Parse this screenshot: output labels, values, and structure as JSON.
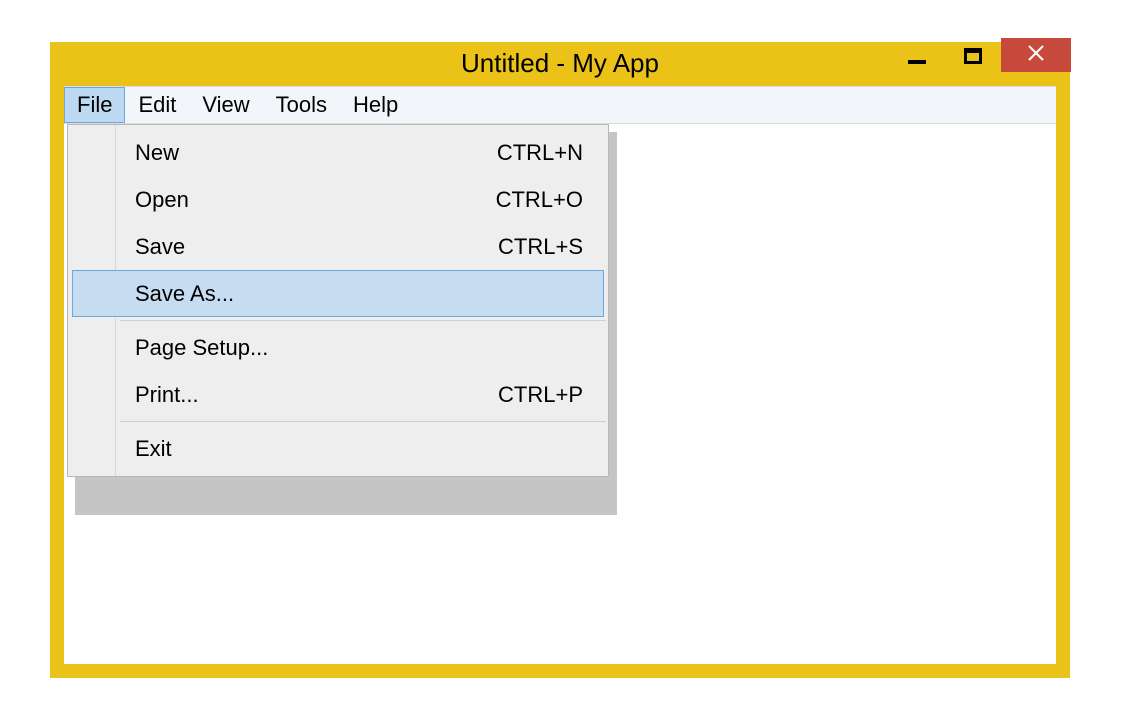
{
  "window": {
    "title": "Untitled - My App"
  },
  "menubar": {
    "items": [
      {
        "label": "File",
        "active": true
      },
      {
        "label": "Edit",
        "active": false
      },
      {
        "label": "View",
        "active": false
      },
      {
        "label": "Tools",
        "active": false
      },
      {
        "label": "Help",
        "active": false
      }
    ]
  },
  "file_menu": {
    "items": [
      {
        "label": "New",
        "shortcut": "CTRL+N",
        "highlight": false
      },
      {
        "label": "Open",
        "shortcut": "CTRL+O",
        "highlight": false
      },
      {
        "label": "Save",
        "shortcut": "CTRL+S",
        "highlight": false
      },
      {
        "label": "Save As...",
        "shortcut": "",
        "highlight": true
      }
    ],
    "group2": [
      {
        "label": "Page Setup...",
        "shortcut": ""
      },
      {
        "label": "Print...",
        "shortcut": "CTRL+P"
      }
    ],
    "group3": [
      {
        "label": "Exit",
        "shortcut": ""
      }
    ]
  }
}
